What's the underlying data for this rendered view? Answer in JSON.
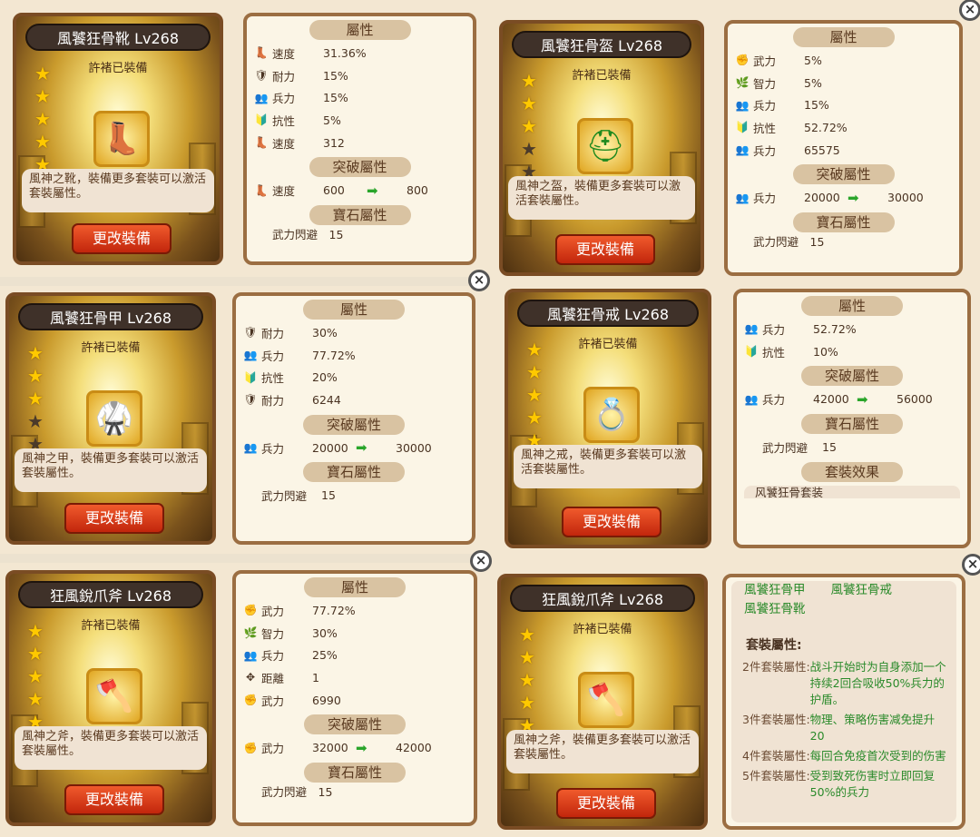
{
  "items": [
    {
      "name": "風饕狂骨靴 Lv268",
      "equipped_by": "許褚已裝備",
      "stars_filled": 5,
      "stars_total": 5,
      "icon": "boots-icon",
      "description": "風神之靴，裝備更多套裝可以激活套裝屬性。",
      "button": "更改裝備",
      "attr_title": "屬性",
      "attrs": [
        {
          "icon": "boot-speed-icon",
          "name": "速度",
          "value": "31.36%"
        },
        {
          "icon": "armor-icon",
          "name": "耐力",
          "value": "15%"
        },
        {
          "icon": "troops-icon",
          "name": "兵力",
          "value": "15%"
        },
        {
          "icon": "resist-icon",
          "name": "抗性",
          "value": "5%"
        },
        {
          "icon": "boot-speed-icon",
          "name": "速度",
          "value": "312"
        }
      ],
      "break_title": "突破屬性",
      "break": {
        "icon": "boot-speed-icon",
        "name": "速度",
        "from": "600",
        "to": "800"
      },
      "gem_title": "寶石屬性",
      "gem_peek": "武力閃避　15"
    },
    {
      "name": "風饕狂骨盔 Lv268",
      "equipped_by": "許褚已裝備",
      "stars_filled": 3,
      "stars_total": 5,
      "icon": "helmet-icon",
      "description": "風神之盔，裝備更多套裝可以激活套裝屬性。",
      "button": "更改裝備",
      "attr_title": "屬性",
      "attrs": [
        {
          "icon": "force-icon",
          "name": "武力",
          "value": "5%"
        },
        {
          "icon": "intellect-icon",
          "name": "智力",
          "value": "5%"
        },
        {
          "icon": "troops-icon",
          "name": "兵力",
          "value": "15%"
        },
        {
          "icon": "resist-icon",
          "name": "抗性",
          "value": "52.72%"
        },
        {
          "icon": "troops-icon",
          "name": "兵力",
          "value": "65575"
        }
      ],
      "break_title": "突破屬性",
      "break": {
        "icon": "troops-icon",
        "name": "兵力",
        "from": "20000",
        "to": "30000"
      },
      "gem_title": "寶石屬性",
      "gem_peek": "武力閃避　15"
    },
    {
      "name": "風饕狂骨甲 Lv268",
      "equipped_by": "許褚已裝備",
      "stars_filled": 3,
      "stars_total": 5,
      "icon": "armor-chest-icon",
      "description": "風神之甲，裝備更多套裝可以激活套裝屬性。",
      "button": "更改裝備",
      "attr_title": "屬性",
      "attrs": [
        {
          "icon": "armor-icon",
          "name": "耐力",
          "value": "30%"
        },
        {
          "icon": "troops-icon",
          "name": "兵力",
          "value": "77.72%"
        },
        {
          "icon": "resist-icon",
          "name": "抗性",
          "value": "20%"
        },
        {
          "icon": "armor-icon",
          "name": "耐力",
          "value": "6244"
        }
      ],
      "break_title": "突破屬性",
      "break": {
        "icon": "troops-icon",
        "name": "兵力",
        "from": "20000",
        "to": "30000"
      },
      "gem_title": "寶石屬性",
      "gem": {
        "name": "武力閃避",
        "value": "15"
      }
    },
    {
      "name": "風饕狂骨戒 Lv268",
      "equipped_by": "許褚已裝備",
      "stars_filled": 5,
      "stars_total": 5,
      "icon": "ring-icon",
      "description": "風神之戒，裝備更多套裝可以激活套裝屬性。",
      "button": "更改裝備",
      "attr_title": "屬性",
      "attrs": [
        {
          "icon": "troops-icon",
          "name": "兵力",
          "value": "52.72%"
        },
        {
          "icon": "resist-icon",
          "name": "抗性",
          "value": "10%"
        }
      ],
      "break_title": "突破屬性",
      "break": {
        "icon": "troops-icon",
        "name": "兵力",
        "from": "42000",
        "to": "56000"
      },
      "gem_title": "寶石屬性",
      "gem": {
        "name": "武力閃避",
        "value": "15"
      },
      "set_title": "套裝效果",
      "set_peek": "风饕狂骨套装"
    },
    {
      "name": "狂風銳爪斧 Lv268",
      "equipped_by": "許褚已裝備",
      "stars_filled": 5,
      "stars_total": 5,
      "icon": "axe-icon",
      "description": "風神之斧，裝備更多套裝可以激活套裝屬性。",
      "button": "更改裝備",
      "attr_title": "屬性",
      "attrs": [
        {
          "icon": "force-icon",
          "name": "武力",
          "value": "77.72%"
        },
        {
          "icon": "intellect-icon",
          "name": "智力",
          "value": "30%"
        },
        {
          "icon": "troops-icon",
          "name": "兵力",
          "value": "25%"
        },
        {
          "icon": "range-icon",
          "name": "距離",
          "value": "1"
        },
        {
          "icon": "force-icon",
          "name": "武力",
          "value": "6990"
        }
      ],
      "break_title": "突破屬性",
      "break": {
        "icon": "force-icon",
        "name": "武力",
        "from": "32000",
        "to": "42000"
      },
      "gem_title": "寶石屬性",
      "gem_peek": "武力閃避　15"
    },
    {
      "name": "狂風銳爪斧 Lv268",
      "equipped_by": "許褚已裝備",
      "stars_filled": 5,
      "stars_total": 5,
      "icon": "axe-icon",
      "description": "風神之斧，裝備更多套裝可以激活套裝屬性。",
      "button": "更改裝備"
    }
  ],
  "set_effects": {
    "pieces_line1": [
      "風饕狂骨甲",
      "風饕狂骨戒"
    ],
    "pieces_line2": "風饕狂骨靴",
    "heading": "套裝屬性:",
    "bonuses": [
      {
        "label": "2件套裝屬性:",
        "text": "战斗开始时为自身添加一个持续2回合吸收50%兵力的护盾。"
      },
      {
        "label": "3件套裝屬性:",
        "text": "物理、策略伤害减免提升20"
      },
      {
        "label": "4件套裝屬性:",
        "text": "每回合免疫首次受到的伤害"
      },
      {
        "label": "5件套裝屬性:",
        "text": "受到致死伤害时立即回复50%的兵力"
      }
    ]
  },
  "colors": {
    "bonus_green": "#2a8a2a",
    "button_red": "#d8381a",
    "star_gold": "#ffc900",
    "arrow_green": "#2aa52a"
  },
  "icons": {
    "boot-speed-icon": "👢",
    "armor-icon": "🛡",
    "troops-icon": "👥",
    "resist-icon": "🔰",
    "force-icon": "✊",
    "intellect-icon": "🌿",
    "range-icon": "✥",
    "boots-icon": "👢",
    "helmet-icon": "⛑",
    "armor-chest-icon": "🥋",
    "ring-icon": "💍",
    "axe-icon": "🪓"
  }
}
